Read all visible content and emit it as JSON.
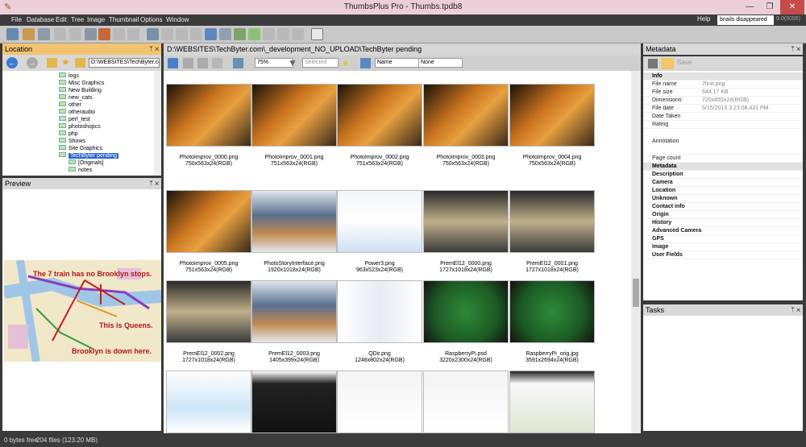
{
  "window": {
    "title": "ThumbsPlus Pro - Thumbs.tpdb8",
    "buttons": [
      "—",
      "❐",
      "✕"
    ]
  },
  "menu": [
    "File",
    "Database",
    "Edit",
    "Tree",
    "Image",
    "Thumbnail",
    "Options",
    "Window"
  ],
  "help": {
    "label": "Help",
    "combo": "bnails disappeared",
    "version": "9.0(3055)"
  },
  "location": {
    "title": "Location",
    "pin": "ᛘ ✕",
    "path": "D:\\WEBSITES\\TechByter.com",
    "tree": [
      "logs",
      "Misc Graphics",
      "New Building",
      "new_cats",
      "other",
      "otheraudio",
      "perl_test",
      "photoshopcs",
      "php",
      "Shows",
      "Site Graphics",
      "TechByter pending",
      "[Originals]",
      "notes"
    ]
  },
  "preview": {
    "title": "Preview",
    "pin": "ᛘ ✕",
    "map_text": [
      "The 7 train has no Brooklyn stops.",
      "This is Queens.",
      "Brooklyn is down here."
    ]
  },
  "content": {
    "path": "D:\\WEBSITES\\TechByter.com\\_development_NO_UPLOAD\\TechByter pending",
    "zoom": "75%",
    "selected": "Selected",
    "sort": "Name",
    "group": "None",
    "thumbs": [
      {
        "name": "PhotoImprov_0000.png",
        "meta": "750x563x24(RGB)",
        "kind": "cat"
      },
      {
        "name": "PhotoImprov_0001.png",
        "meta": "751x563x24(RGB)",
        "kind": "cat"
      },
      {
        "name": "PhotoImprov_0002.png",
        "meta": "751x563x24(RGB)",
        "kind": "cat"
      },
      {
        "name": "PhotoImprov_0003.png",
        "meta": "750x563x24(RGB)",
        "kind": "cat"
      },
      {
        "name": "PhotoImprov_0004.png",
        "meta": "750x563x24(RGB)",
        "kind": "cat"
      },
      {
        "name": "PhotoImprov_0005.png",
        "meta": "751x563x24(RGB)",
        "kind": "cat"
      },
      {
        "name": "PhotoStoryInterface.png",
        "meta": "1920x1018x24(RGB)",
        "kind": "ui"
      },
      {
        "name": "Power3.png",
        "meta": "963x523x24(RGB)",
        "kind": "dialog"
      },
      {
        "name": "PremEl12_0000.png",
        "meta": "1727x1018x24(RGB)",
        "kind": "food"
      },
      {
        "name": "PremEl12_0001.png",
        "meta": "1727x1018x24(RGB)",
        "kind": "food"
      },
      {
        "name": "PremEl12_0002.png",
        "meta": "1727x1018x24(RGB)",
        "kind": "food"
      },
      {
        "name": "PremEl12_0003.png",
        "meta": "1405x399x24(RGB)",
        "kind": "ui"
      },
      {
        "name": "QDir.png",
        "meta": "1246x802x24(RGB)",
        "kind": "files"
      },
      {
        "name": "RaspberryPi.psd",
        "meta": "3220x2300x24(RGB)",
        "kind": "board"
      },
      {
        "name": "RaspberryPi_orig.jpg",
        "meta": "3591x2694x24(RGB)",
        "kind": "board"
      },
      {
        "name": "",
        "meta": "",
        "kind": "diagram"
      },
      {
        "name": "",
        "meta": "",
        "kind": "remote"
      },
      {
        "name": "",
        "meta": "",
        "kind": "page"
      },
      {
        "name": "",
        "meta": "",
        "kind": "page"
      },
      {
        "name": "",
        "meta": "",
        "kind": "web"
      }
    ]
  },
  "metadata": {
    "title": "Metadata",
    "save": "Save",
    "info_label": "Info",
    "rows": [
      [
        "File name",
        "7line.png"
      ],
      [
        "File size",
        "644.17 KB"
      ],
      [
        "Dimensions",
        "720x455x24(RGB)"
      ],
      [
        "File date",
        "5/15/2013 3:23:08,431 PM"
      ],
      [
        "Date Taken",
        ""
      ],
      [
        "Rating",
        ""
      ],
      [
        "Annotation",
        ""
      ],
      [
        "Page count",
        ""
      ]
    ],
    "meta_label": "Metadata",
    "sections": [
      "Description",
      "Camera",
      "Location",
      "Unknown",
      "Contact info",
      "Origin",
      "History",
      "Advanced Camera",
      "GPS",
      "Image",
      "User Fields"
    ]
  },
  "tasks": {
    "title": "Tasks",
    "pin": "ᛘ ✕"
  },
  "status": {
    "free": "0 bytes free",
    "files": "204 files (123.20 MB)"
  }
}
